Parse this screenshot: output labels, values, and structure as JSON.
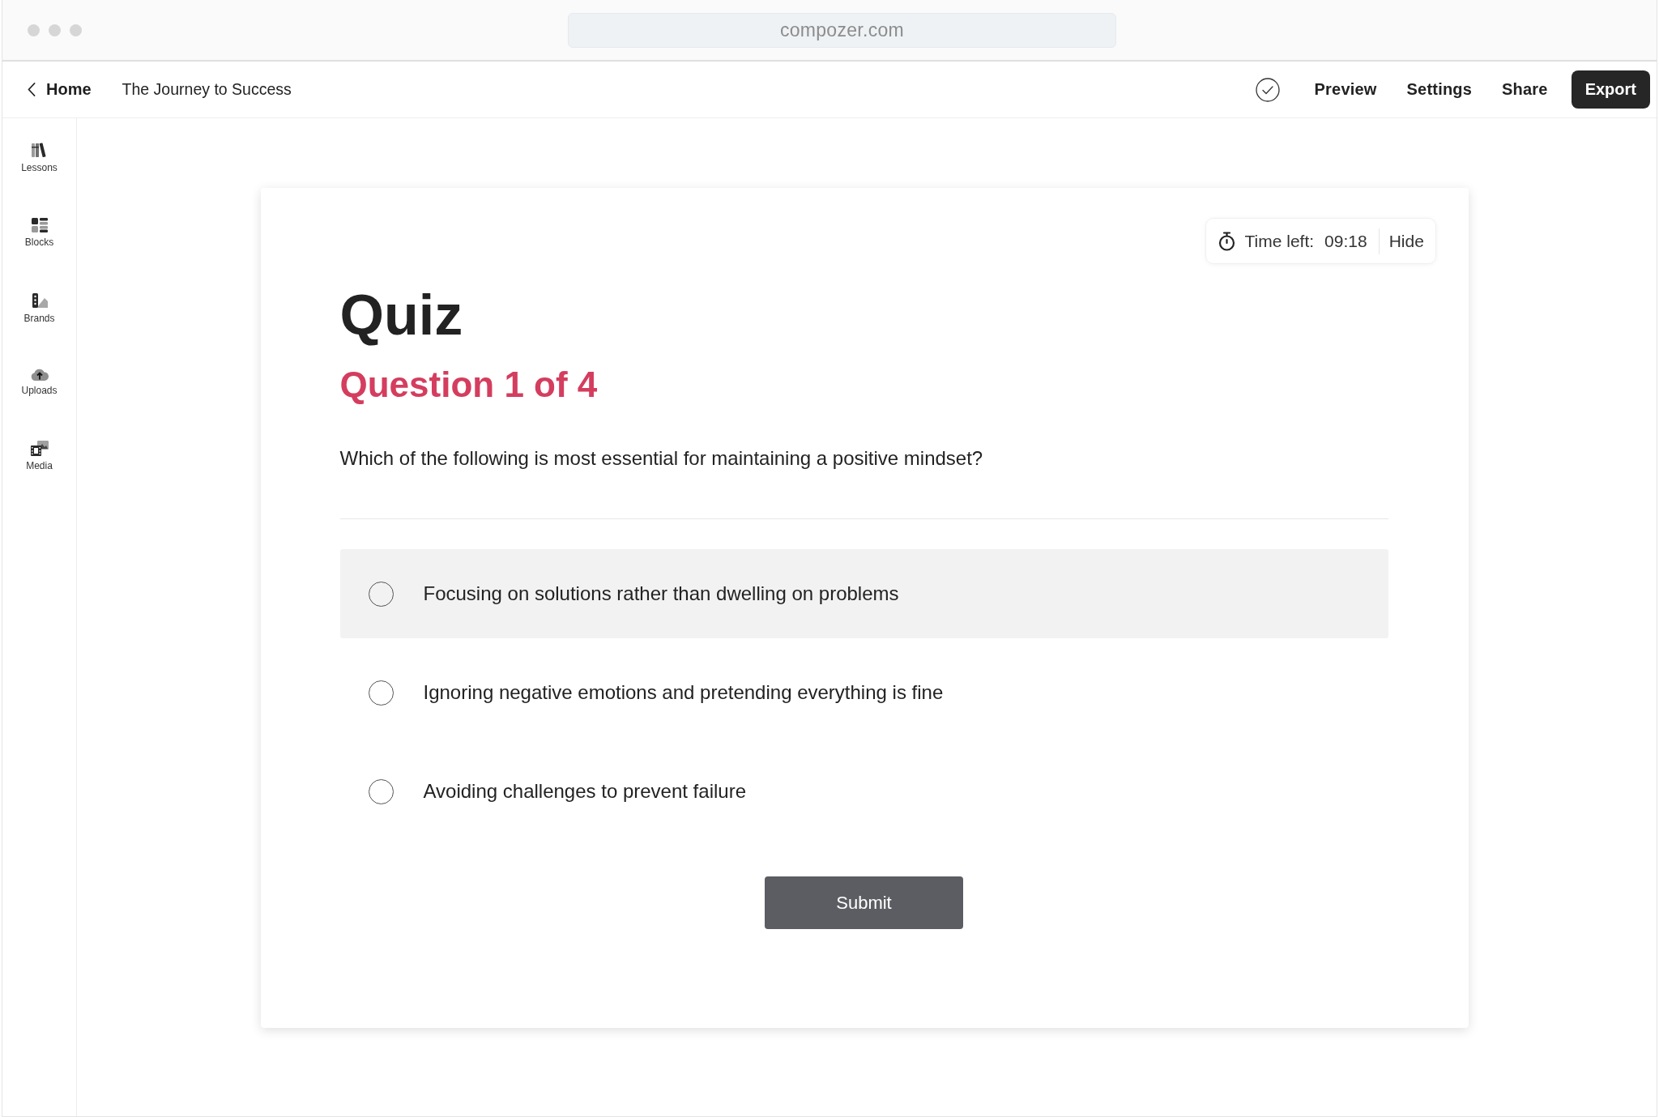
{
  "browser": {
    "address": "compozer.com"
  },
  "header": {
    "back": "Home",
    "title": "The Journey to Success",
    "links": [
      "Preview",
      "Settings",
      "Share"
    ],
    "export": "Export"
  },
  "sidebar": {
    "items": [
      {
        "kind": "lessons",
        "label": "Lessons"
      },
      {
        "kind": "blocks",
        "label": "Blocks"
      },
      {
        "kind": "brands",
        "label": "Brands"
      },
      {
        "kind": "uploads",
        "label": "Uploads"
      },
      {
        "kind": "media",
        "label": "Media"
      }
    ]
  },
  "quiz": {
    "timer": {
      "label": "Time left:",
      "value": "09:18",
      "toggle": "Hide"
    },
    "title": "Quiz",
    "counter": "Question 1 of 4",
    "question": "Which of the following is most essential for maintaining a positive mindset?",
    "options": [
      {
        "text": "Focusing on solutions rather than dwelling on problems",
        "highlighted": true,
        "selected": false
      },
      {
        "text": "Ignoring negative emotions and pretending everything is fine",
        "highlighted": false,
        "selected": false
      },
      {
        "text": "Avoiding challenges to prevent failure",
        "highlighted": false,
        "selected": false
      }
    ],
    "submit": "Submit"
  }
}
